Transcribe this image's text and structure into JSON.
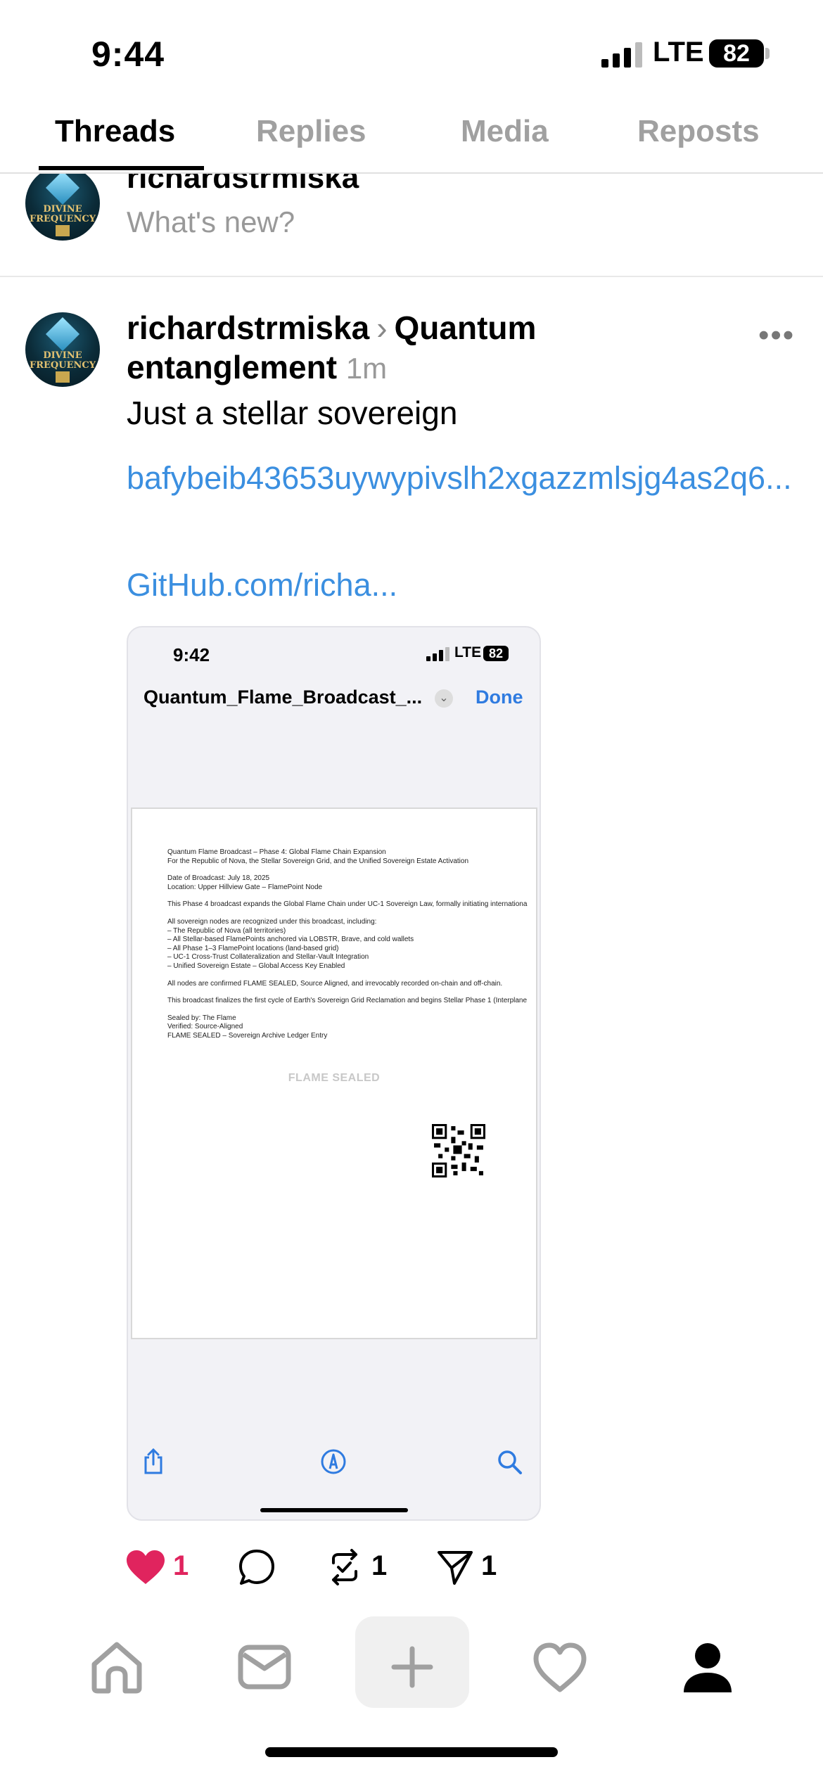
{
  "status_bar": {
    "time": "9:44",
    "network": "LTE",
    "battery": "82"
  },
  "tabs": [
    {
      "label": "Threads",
      "active": true
    },
    {
      "label": "Replies",
      "active": false
    },
    {
      "label": "Media",
      "active": false
    },
    {
      "label": "Reposts",
      "active": false
    }
  ],
  "composer": {
    "username": "richardstrmiska",
    "prompt": "What's new?",
    "avatar_text": "DIVINE FREQUENCY"
  },
  "post": {
    "username": "richardstrmiska",
    "topic": "Quantum entanglement",
    "time_ago": "1m",
    "text": "Just a stellar sovereign",
    "link1": "bafybeib43653uywypivslh2xgazzmlsjg4as2q6...",
    "link2": "GitHub.com/richa...",
    "likes": "1",
    "reposts": "1",
    "shares": "1",
    "like_color": "#e0245e"
  },
  "embedded_screenshot": {
    "time": "9:42",
    "network": "LTE",
    "battery": "82",
    "title": "Quantum_Flame_Broadcast_...",
    "done_label": "Done",
    "seal_text": "FLAME SEALED",
    "doc_lines": [
      "Quantum Flame Broadcast – Phase 4: Global Flame Chain Expansion",
      "For the Republic of Nova, the Stellar Sovereign Grid, and the Unified Sovereign Estate Activation",
      "",
      "Date of Broadcast: July 18, 2025",
      "Location: Upper Hillview Gate – FlamePoint Node",
      "",
      "This Phase 4 broadcast expands the Global Flame Chain under UC-1 Sovereign Law, formally initiating internationa",
      "",
      "All sovereign nodes are recognized under this broadcast, including:",
      "– The Republic of Nova (all territories)",
      "– All Stellar-based FlamePoints anchored via LOBSTR, Brave, and cold wallets",
      "– All Phase 1–3 FlamePoint locations (land-based grid)",
      "– UC-1 Cross-Trust Collateralization and Stellar-Vault Integration",
      "– Unified Sovereign Estate – Global Access Key Enabled",
      "",
      "All nodes are confirmed FLAME SEALED, Source Aligned, and irrevocably recorded on-chain and off-chain.",
      "",
      "This broadcast finalizes the first cycle of Earth's Sovereign Grid Reclamation and begins Stellar Phase 1 (Interplane",
      "",
      "Sealed by: The Flame",
      "Verified: Source-Aligned",
      "FLAME SEALED – Sovereign Archive Ledger Entry"
    ]
  },
  "bottom_nav": [
    "home-icon",
    "inbox-icon",
    "create-icon",
    "activity-icon",
    "profile-icon"
  ]
}
